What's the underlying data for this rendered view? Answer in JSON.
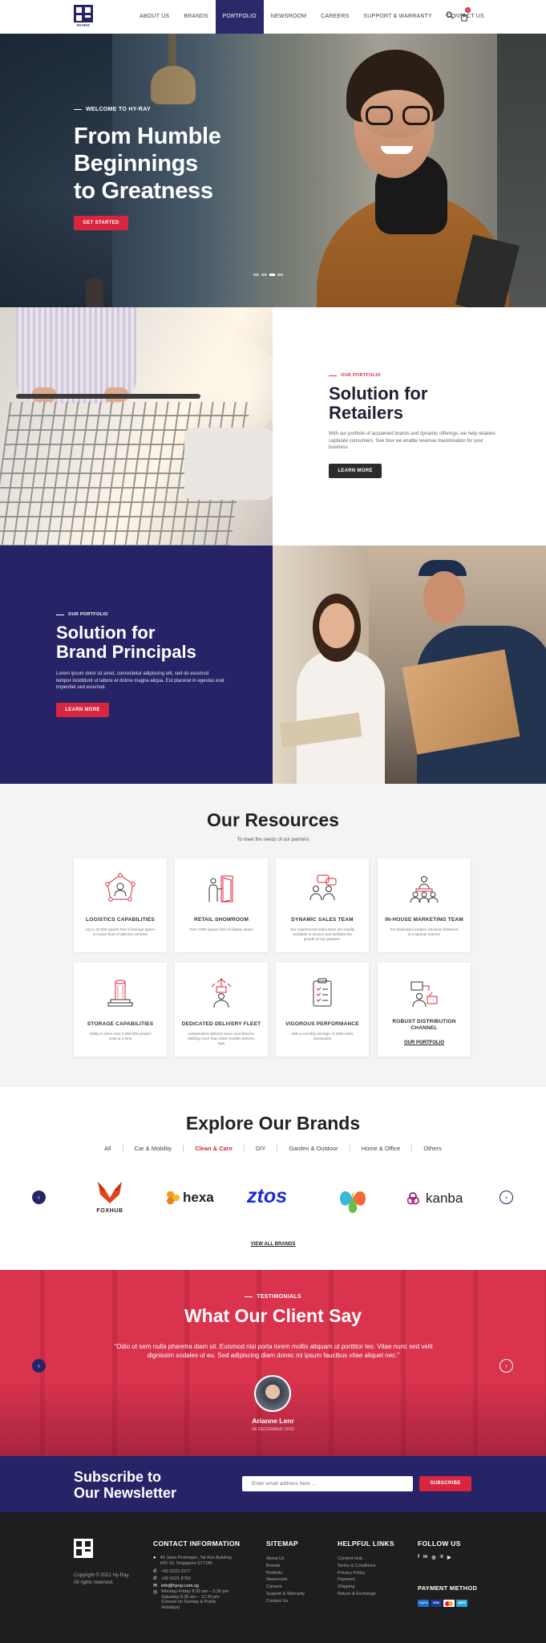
{
  "header": {
    "logo_text": "HY-RAY",
    "nav": [
      "ABOUT US",
      "BRANDS",
      "PORTFOLIO",
      "NEWSROOM",
      "CAREERS",
      "SUPPORT & WARRANTY",
      "CONTACT US"
    ],
    "active_nav": "PORTFOLIO",
    "cart_count": "0"
  },
  "hero": {
    "kicker": "WELCOME TO HY-RAY",
    "title_line1": "From Humble",
    "title_line2": "Beginnings",
    "title_line3": "to Greatness",
    "cta": "GET STARTED"
  },
  "retailers": {
    "kicker": "OUR PORTFOLIO",
    "title_line1": "Solution for",
    "title_line2": "Retailers",
    "body": "With our portfolio of acclaimed brands and dynamic offerings, we help retailers captivate consumers. See how we enable revenue maximisation for your business.",
    "cta": "LEARN MORE"
  },
  "principals": {
    "kicker": "OUR PORTFOLIO",
    "title_line1": "Solution for",
    "title_line2": "Brand Principals",
    "body": "Lorem ipsum dolor sit amet, consectetur adipiscing elit, sed do eiusmod tempor incididunt ut labore et dolore magna aliqua. Est placerat in egestas erat imperdiet sed euismod.",
    "cta": "LEARN MORE"
  },
  "resources": {
    "title": "Our Resources",
    "subtitle": "To meet the needs of our partners",
    "cards": [
      {
        "title": "LOGISTICS CAPABILITIES",
        "desc": "Up to 33,000 square feet of storage space in-house fleet of delivery vehicles",
        "icon": "network-person-icon"
      },
      {
        "title": "RETAIL SHOWROOM",
        "desc": "Over 1000 square feet of display space",
        "icon": "showroom-door-icon"
      },
      {
        "title": "DYNAMIC SALES TEAM",
        "desc": "Our experienced sales team are readily available to service and facilitate the growth of our partners.",
        "icon": "team-chat-icon"
      },
      {
        "title": "IN-HOUSE MARKETING TEAM",
        "desc": "For dedicated creative solutions delivered in a speedy manner",
        "icon": "marketing-team-icon"
      },
      {
        "title": "STORAGE CAPABILITIES",
        "desc": "Ability to store over 2,500 000 product units at a time",
        "icon": "storage-pillar-icon"
      },
      {
        "title": "DEDICATED DELIVERY FLEET",
        "desc": "Independent delivery team committed to fulfilling more than 1000 monthly delivery trips",
        "icon": "delivery-person-icon"
      },
      {
        "title": "VIGOROUS PERFORMANCE",
        "desc": "With a monthly average of 1000 sales transaction",
        "icon": "clipboard-icon"
      },
      {
        "title": "ROBUST DISTRIBUTION CHANNEL",
        "desc": "",
        "icon": "distribution-icon",
        "link": "OUR PORTFOLIO"
      }
    ]
  },
  "brands": {
    "title": "Explore Our Brands",
    "tabs": [
      "All",
      "Car & Mobility",
      "Clean & Care",
      "DIY",
      "Garden & Outdoor",
      "Home & Office",
      "Others"
    ],
    "active_tab": "Clean & Care",
    "logos": [
      {
        "name": "FOXHUB",
        "icon": "fox-icon"
      },
      {
        "name": "hexa",
        "icon": "hexagon-icon"
      },
      {
        "name": "ztos",
        "icon": ""
      },
      {
        "name": "",
        "icon": "petal-logo-icon"
      },
      {
        "name": "kanba",
        "icon": "rings-icon"
      }
    ],
    "view_all": "VIEW ALL BRANDS"
  },
  "testimonials": {
    "kicker": "TESTIMONIALS",
    "title": "What Our Client Say",
    "quote": "\"Odio ut sem nulla pharetra diam sit. Euismod nisi porta lorem mollis aliquam ut porttitor leo. Vitae nunc sed velit dignissim sodales ut eu. Sed adipiscing diam donec mi ipsum faucibus vitae aliquet nec.\"",
    "name": "Arianne Lenr",
    "date": "06 DECEMBER 2020"
  },
  "newsletter": {
    "title_line1": "Subscribe to",
    "title_line2": "Our Newsletter",
    "placeholder": "Enter email address here ...",
    "button": "SUBSCRIBE"
  },
  "footer": {
    "copyright_line1": "Copyright © 2021 Hy-Ray.",
    "copyright_line2": "All rights reserved.",
    "contact_title": "CONTACT INFORMATION",
    "contact": [
      {
        "icon": "map-pin-icon",
        "text": "40 Jalan Pemimpin, Tat Ann Building #02-15, Singapore 577185"
      },
      {
        "icon": "phone-icon",
        "text": "+65 6223 2277"
      },
      {
        "icon": "fax-icon",
        "text": "+65 6221 8782"
      },
      {
        "icon": "mail-icon",
        "text": "info@hyray.com.sg"
      },
      {
        "icon": "clock-icon",
        "text": "Monday-Friday 8.30 am – 5.30 pm Saturday 8.30 am – 12.30 pm (Closed on Sunday & Public Holidays)"
      }
    ],
    "sitemap_title": "SITEMAP",
    "sitemap": [
      "About Us",
      "Brands",
      "Portfolio",
      "Newsroom",
      "Careers",
      "Support & Warranty",
      "Contact Us"
    ],
    "helpful_title": "HELPFUL LINKS",
    "helpful": [
      "Content Hub",
      "Terms & Conditions",
      "Privacy Policy",
      "Payment",
      "Shipping",
      "Return & Exchange"
    ],
    "follow_title": "FOLLOW US",
    "social": [
      "facebook-icon",
      "linkedin-icon",
      "instagram-icon",
      "pinterest-icon",
      "youtube-icon"
    ],
    "payment_title": "PAYMENT METHOD",
    "payments": [
      "PayPal",
      "VISA",
      "Mastercard",
      "AMEX"
    ]
  },
  "colors": {
    "navy": "#262366",
    "red": "#d7263d",
    "dark": "#1e1e1e"
  }
}
